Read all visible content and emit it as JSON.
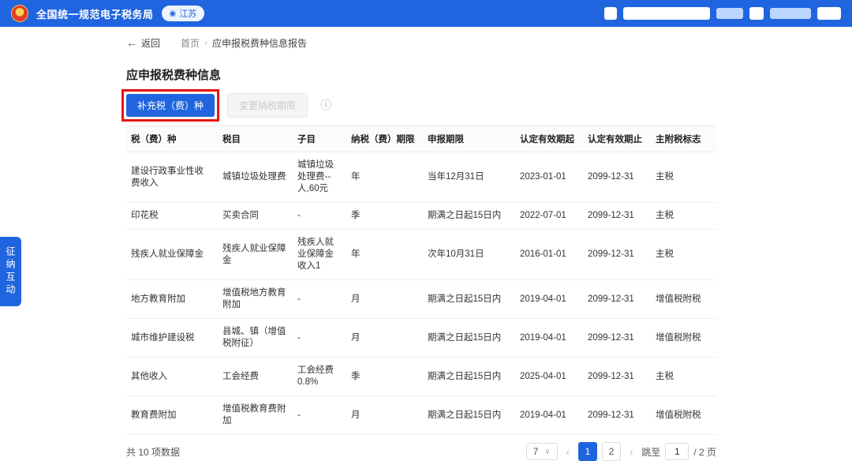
{
  "colors": {
    "brand": "#2065df",
    "annotation_red": "#e8140a",
    "badge_bg": "#eef4ff"
  },
  "icons": {
    "back_arrow": "←",
    "crumb_separator": "›",
    "location_pin": "◉",
    "info": "ⓘ",
    "chevron_down": "∨",
    "prev": "‹",
    "next": "›"
  },
  "header": {
    "app_title": "全国统一规范电子税务局",
    "region_badge": "江苏"
  },
  "breadcrumb": {
    "back_label": "返回",
    "home": "首页",
    "current": "应申报税费种信息报告"
  },
  "side_tab": {
    "label": "征纳互动"
  },
  "main": {
    "section_title": "应申报税费种信息",
    "toolbar": {
      "supplement_button": "补充税（费）种",
      "change_deadline_button": "变更纳税期限"
    },
    "table": {
      "headers": [
        "税（费）种",
        "税目",
        "子目",
        "纳税（费）期限",
        "申报期限",
        "认定有效期起",
        "认定有效期止",
        "主附税标志"
      ],
      "rows": [
        [
          "建设行政事业性收费收入",
          "城镇垃圾处理费",
          "城镇垃圾处理费--人,60元",
          "年",
          "当年12月31日",
          "2023-01-01",
          "2099-12-31",
          "主税"
        ],
        [
          "印花税",
          "买卖合同",
          "-",
          "季",
          "期满之日起15日内",
          "2022-07-01",
          "2099-12-31",
          "主税"
        ],
        [
          "残疾人就业保障金",
          "残疾人就业保障金",
          "残疾人就业保障金收入1",
          "年",
          "次年10月31日",
          "2016-01-01",
          "2099-12-31",
          "主税"
        ],
        [
          "地方教育附加",
          "增值税地方教育附加",
          "-",
          "月",
          "期满之日起15日内",
          "2019-04-01",
          "2099-12-31",
          "增值税附税"
        ],
        [
          "城市维护建设税",
          "县城、镇（增值税附征）",
          "-",
          "月",
          "期满之日起15日内",
          "2019-04-01",
          "2099-12-31",
          "增值税附税"
        ],
        [
          "其他收入",
          "工会经费",
          "工会经费0.8%",
          "季",
          "期满之日起15日内",
          "2025-04-01",
          "2099-12-31",
          "主税"
        ],
        [
          "教育费附加",
          "增值税教育费附加",
          "-",
          "月",
          "期满之日起15日内",
          "2019-04-01",
          "2099-12-31",
          "增值税附税"
        ]
      ]
    },
    "pagination": {
      "total_text": "共 10 项数据",
      "page_size": "7",
      "pages": [
        "1",
        "2"
      ],
      "active_page": "1",
      "jump_label": "跳至",
      "jump_value": "1",
      "page_suffix": "/ 2 页"
    }
  }
}
